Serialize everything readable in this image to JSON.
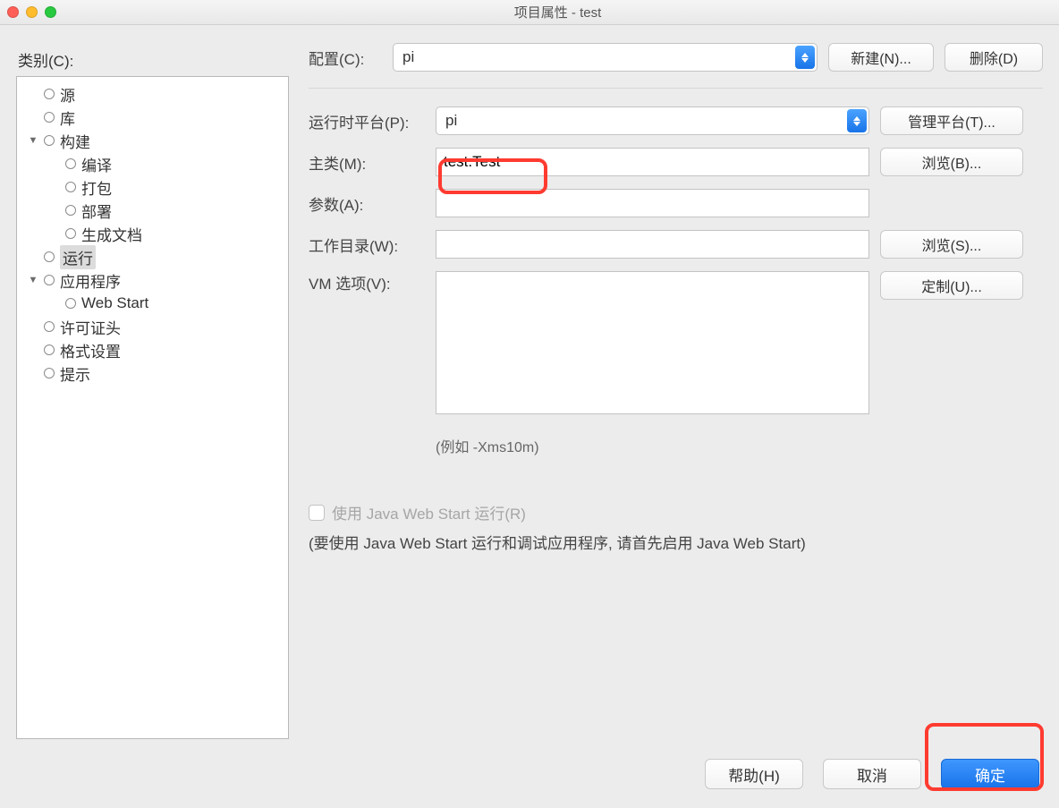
{
  "window": {
    "title": "项目属性 - test"
  },
  "left": {
    "categories_label": "类别(C):",
    "items": {
      "source": "源",
      "library": "库",
      "build": "构建",
      "compile": "编译",
      "package": "打包",
      "deploy": "部署",
      "gendoc": "生成文档",
      "run": "运行",
      "app": "应用程序",
      "webstart": "Web Start",
      "license": "许可证头",
      "format": "格式设置",
      "hints": "提示"
    }
  },
  "form": {
    "config_label": "配置(C):",
    "config_value": "pi",
    "new_btn": "新建(N)...",
    "delete_btn": "删除(D)",
    "runtime_label": "运行时平台(P):",
    "runtime_value": "pi",
    "manage_platform_btn": "管理平台(T)...",
    "main_class_label": "主类(M):",
    "main_class_value": "test.Test",
    "browse_b_btn": "浏览(B)...",
    "args_label": "参数(A):",
    "args_value": "",
    "workdir_label": "工作目录(W):",
    "workdir_value": "",
    "browse_s_btn": "浏览(S)...",
    "vm_label": "VM 选项(V):",
    "vm_value": "",
    "custom_btn": "定制(U)...",
    "vm_hint": "(例如 -Xms10m)",
    "webstart_checkbox": "使用 Java Web Start 运行(R)",
    "webstart_note": "(要使用 Java Web Start 运行和调试应用程序, 请首先启用 Java Web Start)"
  },
  "footer": {
    "help": "帮助(H)",
    "cancel": "取消",
    "ok": "确定"
  }
}
